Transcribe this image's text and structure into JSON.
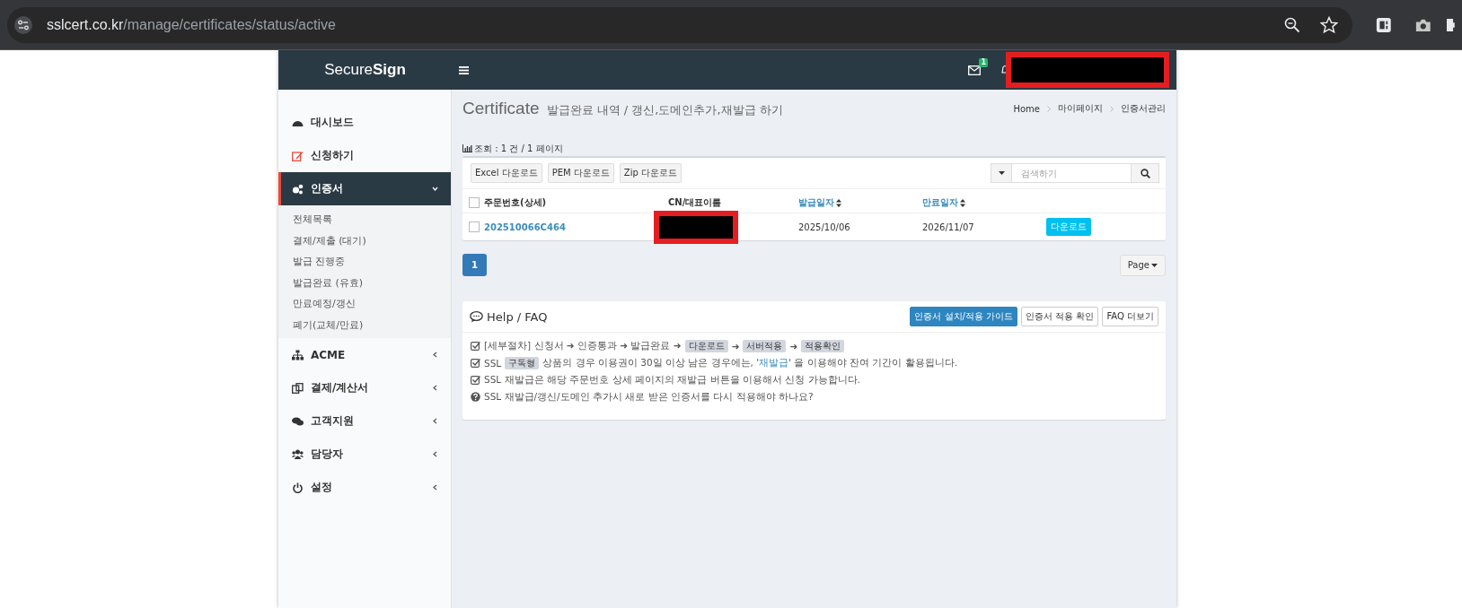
{
  "browser": {
    "url_host": "sslcert.co.kr",
    "url_path": "/manage/certificates/status/active"
  },
  "header": {
    "logo_light": "Secure",
    "logo_bold": "Sign",
    "mail_badge": "1"
  },
  "sidebar": {
    "items": [
      {
        "label": "대시보드",
        "expanded": false,
        "has_children": false
      },
      {
        "label": "신청하기",
        "expanded": false,
        "has_children": false
      },
      {
        "label": "인증서",
        "expanded": true,
        "has_children": true,
        "children": [
          {
            "label": "전체목록"
          },
          {
            "label": "결제/제출 (대기)"
          },
          {
            "label": "발급 진행중"
          },
          {
            "label": "발급완료 (유효)"
          },
          {
            "label": "만료예정/갱신"
          },
          {
            "label": "폐기(교체/만료)"
          }
        ]
      },
      {
        "label": "ACME",
        "expanded": false,
        "has_children": true
      },
      {
        "label": "결제/계산서",
        "expanded": false,
        "has_children": true
      },
      {
        "label": "고객지원",
        "expanded": false,
        "has_children": true
      },
      {
        "label": "담당자",
        "expanded": false,
        "has_children": true
      },
      {
        "label": "설정",
        "expanded": false,
        "has_children": true
      }
    ]
  },
  "page": {
    "title": "Certificate",
    "subtitle": "발급완료 내역 / 갱신,도메인추가,재발급 하기",
    "breadcrumb": [
      "Home",
      "마이페이지",
      "인증서관리"
    ]
  },
  "summary": "조회 : 1 건 / 1 페이지",
  "toolbar": {
    "buttons": [
      "Excel 다운로드",
      "PEM 다운로드",
      "Zip 다운로드"
    ],
    "search_placeholder": "검색하기"
  },
  "table": {
    "select_all_checked": false,
    "columns": [
      {
        "label": "주문번호(상세)",
        "sortable": false
      },
      {
        "label": "CN/대표이름",
        "sortable": false
      },
      {
        "label": "발급일자",
        "sortable": true
      },
      {
        "label": "만료일자",
        "sortable": true
      }
    ],
    "rows": [
      {
        "checked": false,
        "order": "202510066C464",
        "issued": "2025/10/06",
        "expires": "2026/11/07",
        "action": "다운로드"
      }
    ]
  },
  "pagination": {
    "pages": [
      {
        "label": "1",
        "selected": true
      }
    ],
    "page_size": "Page"
  },
  "help": {
    "title": "Help / FAQ",
    "buttons": [
      {
        "label": "인증서 설치/적용 가이드",
        "primary": true
      },
      {
        "label": "인증서 적용 확인",
        "primary": false
      },
      {
        "label": "FAQ 더보기",
        "primary": false
      }
    ],
    "lines": [
      {
        "kind": "check",
        "parts": [
          {
            "kind": "text",
            "text": "[세부절차] 신청서 ➜ 인증통과 ➜ 발급완료 ➜"
          },
          {
            "kind": "tag",
            "text": "다운로드"
          },
          {
            "kind": "text",
            "text": "➜"
          },
          {
            "kind": "tag",
            "text": "서버적용"
          },
          {
            "kind": "text",
            "text": "➜"
          },
          {
            "kind": "tag",
            "text": "적용확인"
          }
        ]
      },
      {
        "kind": "check",
        "parts": [
          {
            "kind": "text",
            "text": "SSL"
          },
          {
            "kind": "tag",
            "text": "구독형"
          },
          {
            "kind": "text",
            "text": "상품의 경우 이용권이 30일 이상 남은 경우에는, '"
          },
          {
            "kind": "link",
            "text": "재발급"
          },
          {
            "kind": "text",
            "text": "' 을 이용해야 잔여 기간이 활용됩니다."
          }
        ]
      },
      {
        "kind": "check",
        "parts": [
          {
            "kind": "text",
            "text": "SSL 재발급은 해당 주문번호 상세 페이지의 재발급 버튼을 이용해서 신청 가능합니다."
          }
        ]
      },
      {
        "kind": "question",
        "parts": [
          {
            "kind": "text",
            "text": "SSL 재발급/갱신/도메인 추가시 새로 받은 인증서를 다시 적용해야 하나요?"
          }
        ]
      }
    ]
  }
}
